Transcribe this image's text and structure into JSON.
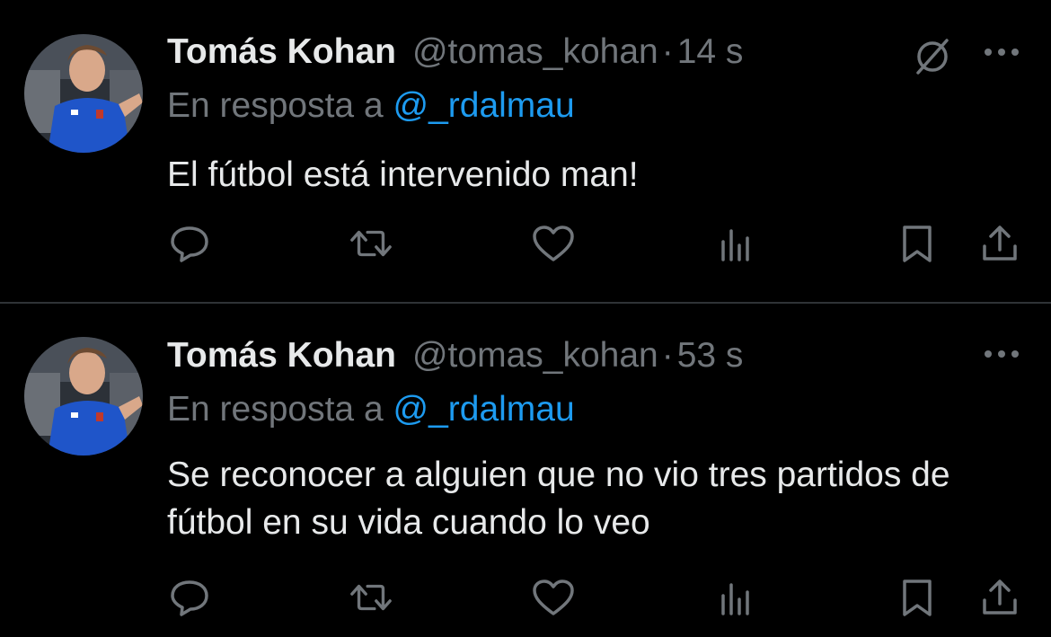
{
  "tweets": [
    {
      "author_name": "Tomás Kohan",
      "handle": "@tomas_kohan",
      "separator": "·",
      "time": "14 s",
      "reply_prefix": "En resposta a",
      "reply_to": "@_rdalmau",
      "text": "El fútbol está intervenido man!",
      "has_grok_icon": true
    },
    {
      "author_name": "Tomás Kohan",
      "handle": "@tomas_kohan",
      "separator": "·",
      "time": "53 s",
      "reply_prefix": "En resposta a",
      "reply_to": "@_rdalmau",
      "text": "Se reconocer a alguien que no vio tres partidos de fútbol en su vida cuando lo veo",
      "has_grok_icon": false
    }
  ],
  "icons": {
    "reply": "reply-icon",
    "retweet": "retweet-icon",
    "like": "like-icon",
    "views": "views-icon",
    "bookmark": "bookmark-icon",
    "share": "share-icon",
    "more": "more-icon",
    "grok": "grok-icon"
  },
  "colors": {
    "background": "#000000",
    "text": "#e7e9ea",
    "muted": "#71767b",
    "link": "#1d9bf0",
    "divider": "#2f3336"
  }
}
